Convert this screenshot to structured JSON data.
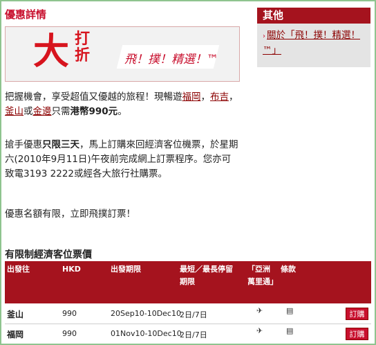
{
  "main": {
    "title": "優惠詳情",
    "banner": {
      "big": "大",
      "small": "打折",
      "slogan": "飛！撲！精選！™"
    },
    "p1": {
      "t1": "把握機會，享受超值又優越的旅程！現暢遊",
      "l1": "福岡",
      "t2": "，",
      "l2": "布吉",
      "t3": "，",
      "l3": "釜山",
      "t4": "或",
      "l4": "金邊",
      "t5": "只需",
      "price": "港幣990元",
      "t6": "。"
    },
    "p2": {
      "t1": "搶手優惠",
      "bold": "只限三天",
      "t2": "，馬上訂購來回經濟客位機票，於星期六(2010年9月11日)午夜前完成網上訂票程序。您亦可致電3193 2222或經各大旅行社購票。"
    },
    "p3": "優惠名額有限，立即飛撲訂票！"
  },
  "sidebar": {
    "heading": "其他",
    "link": "關於「飛！撲！精選！™」"
  },
  "table": {
    "title": "有限制經濟客位票價",
    "headers": [
      "出發往",
      "HKD",
      "出發期限",
      "最短／最長停留期限",
      "「亞洲萬里通」",
      "條款"
    ],
    "rows": [
      {
        "city": "釜山",
        "hkd": "990",
        "period": "20Sep10-10Dec10",
        "stay": "2日/7日",
        "book": "訂購"
      },
      {
        "city": "福岡",
        "hkd": "990",
        "period": "01Nov10-10Dec10",
        "stay": "2日/7日",
        "book": "訂購"
      }
    ]
  },
  "colors": {
    "brand_red": "#a5131e",
    "link": "#8b0000",
    "frame": "#8fc48f"
  }
}
